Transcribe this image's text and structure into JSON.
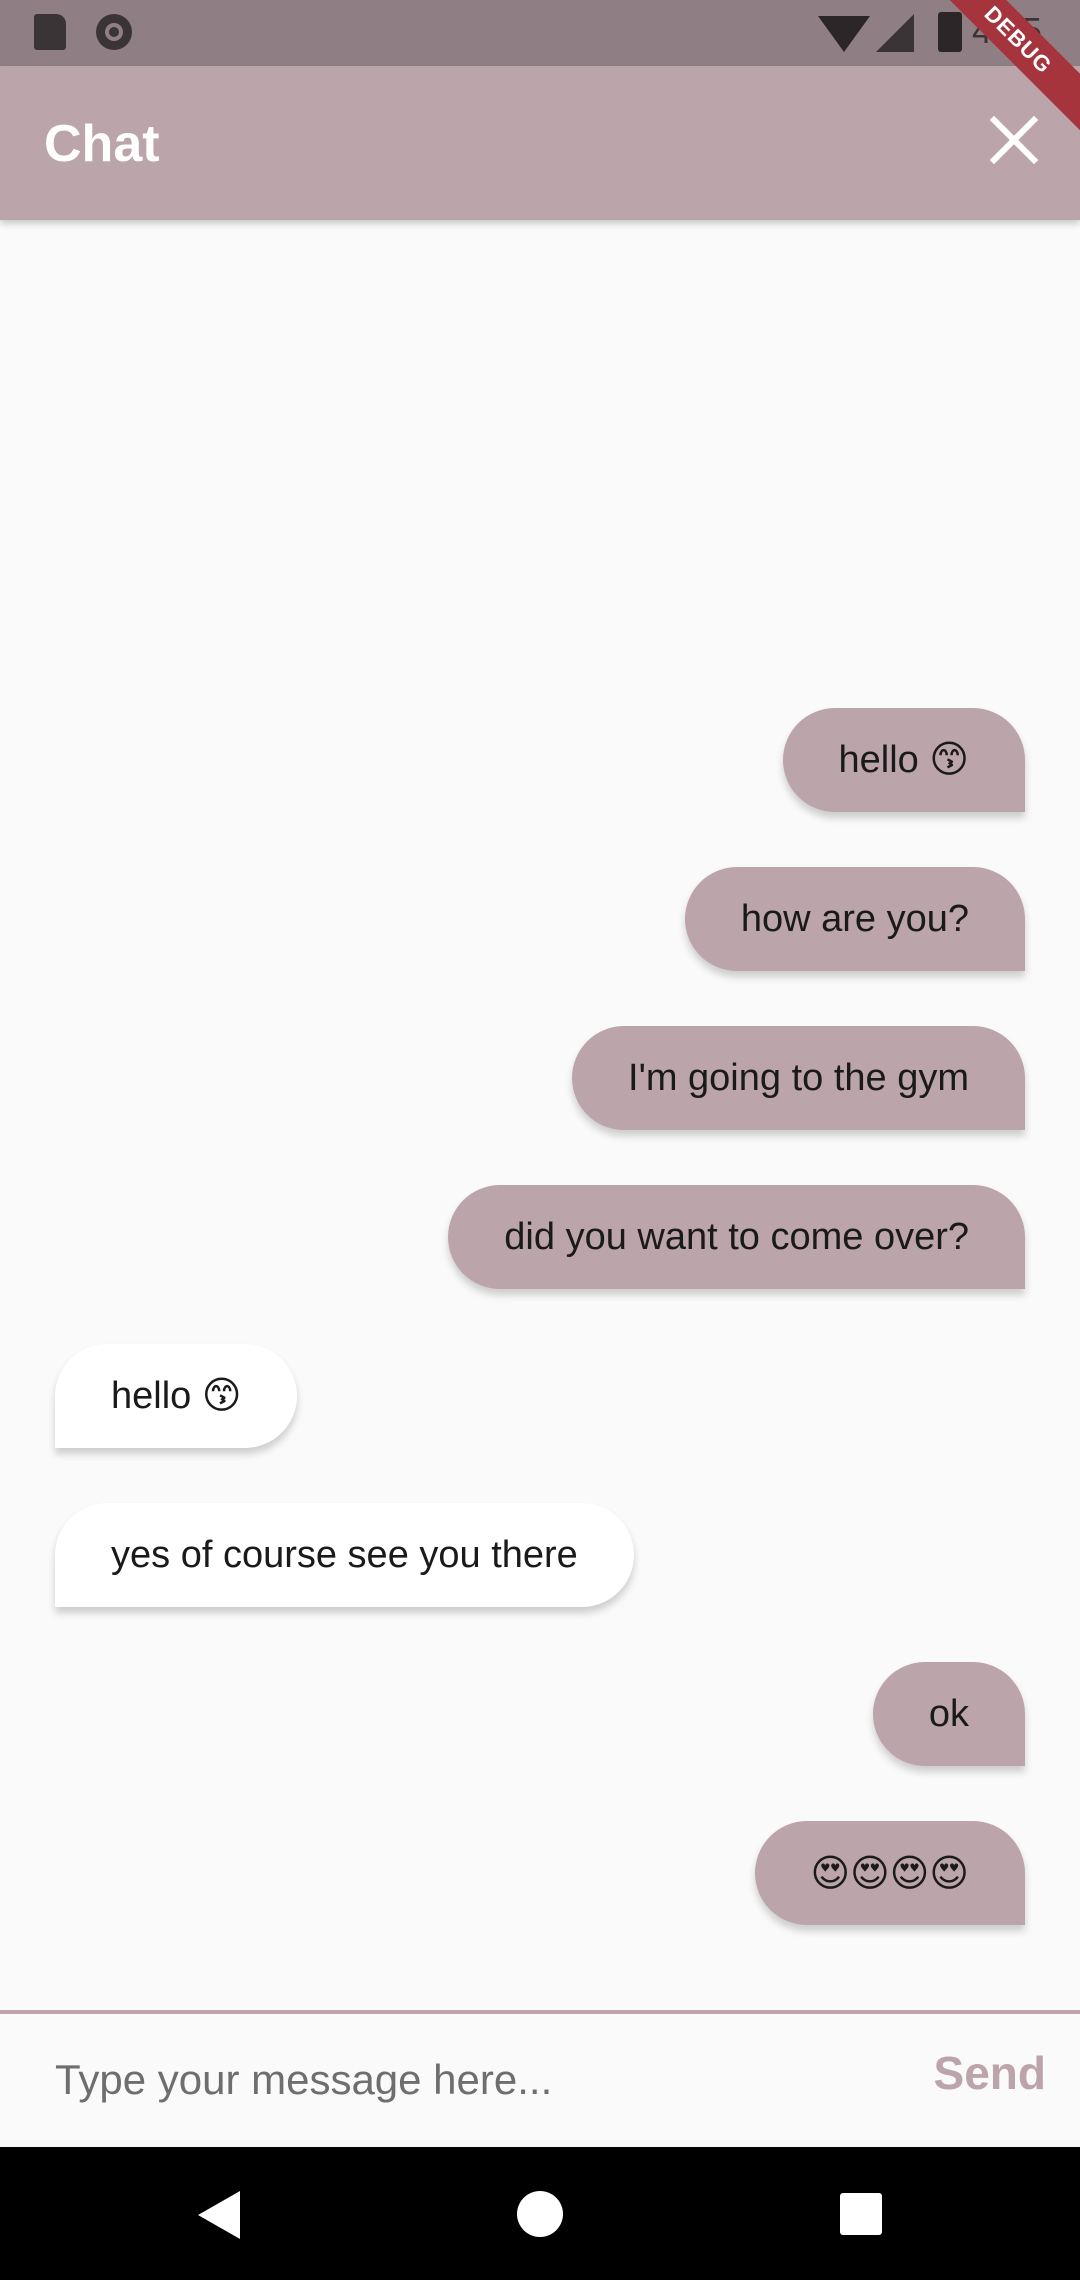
{
  "status_bar": {
    "time": "4:15",
    "icons": [
      "sd-card-icon",
      "sync-circle-icon",
      "wifi-icon",
      "signal-icon",
      "battery-icon"
    ]
  },
  "debug_banner": "DEBUG",
  "app_bar": {
    "title": "Chat",
    "close_icon": "close-icon"
  },
  "messages": [
    {
      "sender": "me",
      "text": "hello 😙"
    },
    {
      "sender": "me",
      "text": "how are you?"
    },
    {
      "sender": "me",
      "text": "I'm going to the gym"
    },
    {
      "sender": "me",
      "text": "did you want to come over?"
    },
    {
      "sender": "them",
      "text": "hello 😙"
    },
    {
      "sender": "them",
      "text": "yes of course see you there"
    },
    {
      "sender": "me",
      "text": "ok"
    },
    {
      "sender": "me",
      "text": "😍😍😍😍"
    }
  ],
  "composer": {
    "placeholder": "Type your message here...",
    "value": "",
    "send_label": "Send"
  },
  "colors": {
    "accent": "#bba4aa",
    "status_bar": "#8f7e84",
    "incoming_bubble": "#ffffff",
    "background": "#fafafa"
  },
  "nav_bar": {
    "icons": [
      "back-icon",
      "home-icon",
      "recents-icon"
    ]
  }
}
